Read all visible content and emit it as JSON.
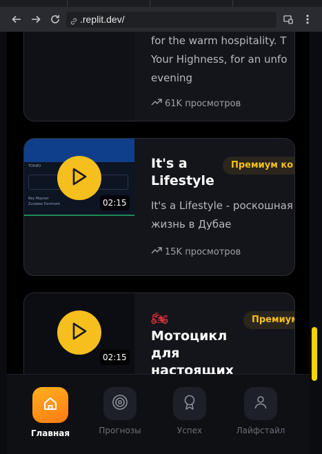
{
  "browser": {
    "url": ".replit.dev/"
  },
  "cards": [
    {
      "description_lines": [
        "for the warm hospitality. T",
        "Your Highness, for an unfo",
        "evening"
      ],
      "views": "61K просмотров"
    },
    {
      "title": "It's a Lifestyle",
      "badge": "Премиум ко",
      "duration": "02:15",
      "description_lines": [
        "It's a Lifestyle - роскошная",
        "жизнь в Дубае"
      ],
      "views": "15K просмотров",
      "thumb_text": [
        "ТОКИО",
        "Rey Maynet",
        "Zurabee Dorimont"
      ]
    },
    {
      "emoji": "🏍",
      "title": "Мотоцикл для настоящих",
      "badge": "Премиум",
      "duration": "02:15"
    }
  ],
  "nav": {
    "items": [
      {
        "label": "Главная",
        "icon": "home-icon",
        "active": true
      },
      {
        "label": "Прогнозы",
        "icon": "target-icon",
        "active": false
      },
      {
        "label": "Успех",
        "icon": "award-icon",
        "active": false
      },
      {
        "label": "Лайфстайл",
        "icon": "user-icon",
        "active": false
      }
    ]
  },
  "colors": {
    "accent": "#f5bf1d",
    "nav_active_gradient": [
      "#ffb020",
      "#ff7b12"
    ],
    "scrollbar": "#f5d400"
  }
}
